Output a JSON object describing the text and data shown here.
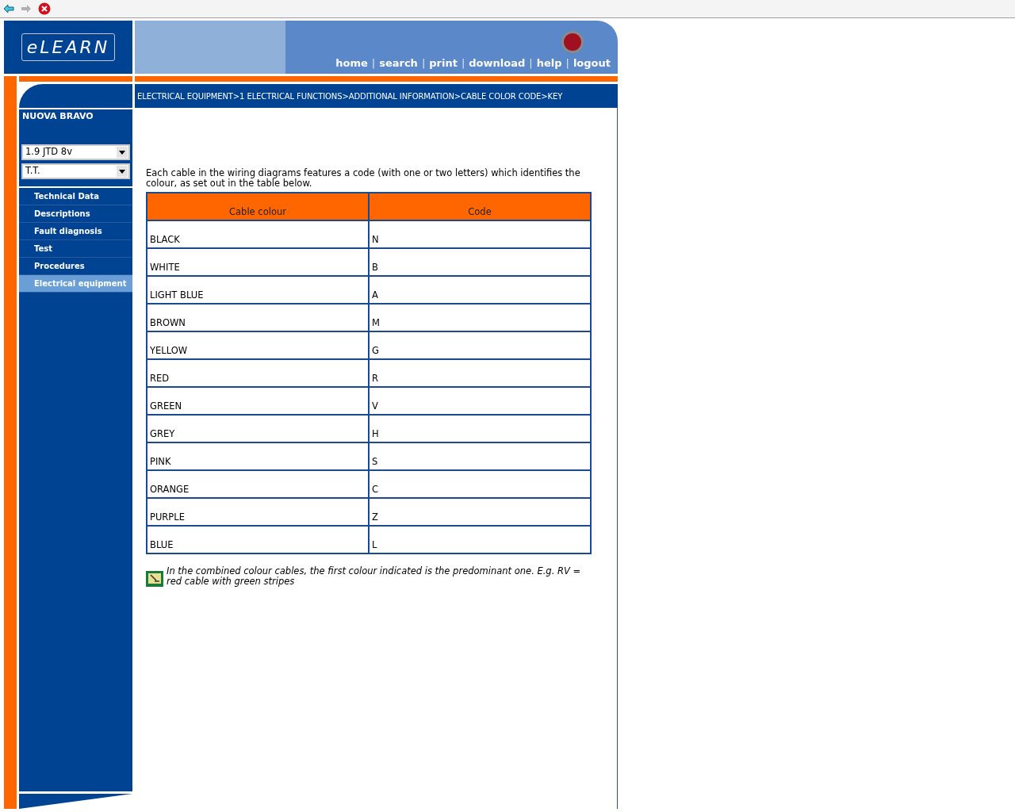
{
  "logo": "eLEARN",
  "nav_links": [
    {
      "kind": "link",
      "label": "home"
    },
    {
      "kind": "separator",
      "label": "|"
    },
    {
      "kind": "link",
      "label": "search"
    },
    {
      "kind": "separator",
      "label": "|"
    },
    {
      "kind": "link",
      "label": "print"
    },
    {
      "kind": "separator",
      "label": "|"
    },
    {
      "kind": "link",
      "label": "download"
    },
    {
      "kind": "separator",
      "label": "|"
    },
    {
      "kind": "link",
      "label": "help"
    },
    {
      "kind": "separator",
      "label": "|"
    },
    {
      "kind": "link",
      "label": "logout"
    }
  ],
  "breadcrumb": "ELECTRICAL EQUIPMENT>1 ELECTRICAL FUNCTIONS>ADDITIONAL INFORMATION>CABLE COLOR CODE>KEY",
  "sidebar": {
    "model": "NUOVA BRAVO",
    "selects": [
      {
        "value": "1.9 JTD 8v"
      },
      {
        "value": "T.T."
      }
    ],
    "items": [
      {
        "label": "Technical Data",
        "selected": false
      },
      {
        "label": "Descriptions",
        "selected": false
      },
      {
        "label": "Fault diagnosis",
        "selected": false
      },
      {
        "label": "Test",
        "selected": false
      },
      {
        "label": "Procedures",
        "selected": false
      },
      {
        "label": "Electrical equipment",
        "selected": true
      }
    ]
  },
  "intro": "Each cable in the wiring diagrams features a code (with one or two letters) which identifies the colour, as set out in the table below.",
  "table": {
    "columns": [
      "Cable colour",
      "Code"
    ],
    "rows": [
      [
        "BLACK",
        "N"
      ],
      [
        "WHITE",
        "B"
      ],
      [
        "LIGHT BLUE",
        "A"
      ],
      [
        "BROWN",
        "M"
      ],
      [
        "YELLOW",
        "G"
      ],
      [
        "RED",
        "R"
      ],
      [
        "GREEN",
        "V"
      ],
      [
        "GREY",
        "H"
      ],
      [
        "PINK",
        "S"
      ],
      [
        "ORANGE",
        "C"
      ],
      [
        "PURPLE",
        "Z"
      ],
      [
        "BLUE",
        "L"
      ]
    ]
  },
  "note": "In the combined colour cables, the first colour indicated is the predominant one. E.g. RV = red cable with green stripes"
}
